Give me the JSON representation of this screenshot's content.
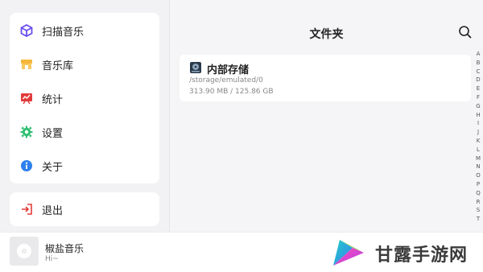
{
  "sidebar": {
    "items": [
      {
        "label": "扫描音乐",
        "icon": "scan-cube-icon"
      },
      {
        "label": "音乐库",
        "icon": "library-icon"
      },
      {
        "label": "统计",
        "icon": "stats-icon"
      },
      {
        "label": "设置",
        "icon": "gear-icon"
      },
      {
        "label": "关于",
        "icon": "info-icon"
      }
    ],
    "logout": {
      "label": "退出",
      "icon": "logout-icon"
    }
  },
  "main": {
    "title": "文件夹",
    "search_icon": "search-icon",
    "storage": {
      "name": "内部存储",
      "path": "/storage/emulated/0",
      "size": "313.90 MB / 125.86 GB",
      "icon": "disk-icon"
    },
    "alphabet": [
      "A",
      "B",
      "C",
      "D",
      "E",
      "F",
      "G",
      "H",
      "I",
      "J",
      "K",
      "L",
      "M",
      "N",
      "O",
      "P",
      "Q",
      "R",
      "S",
      "T"
    ]
  },
  "player": {
    "song": "椒盐音乐",
    "subtitle": "Hi~"
  },
  "watermark": {
    "text": "甘露手游网"
  },
  "colors": {
    "scan": "#6a4cf0",
    "library": "#f5b73b",
    "stats": "#e23b3b",
    "settings": "#2fbf71",
    "about": "#2f80ed",
    "logout": "#e23b3b",
    "disk": "#2b3a4a"
  }
}
